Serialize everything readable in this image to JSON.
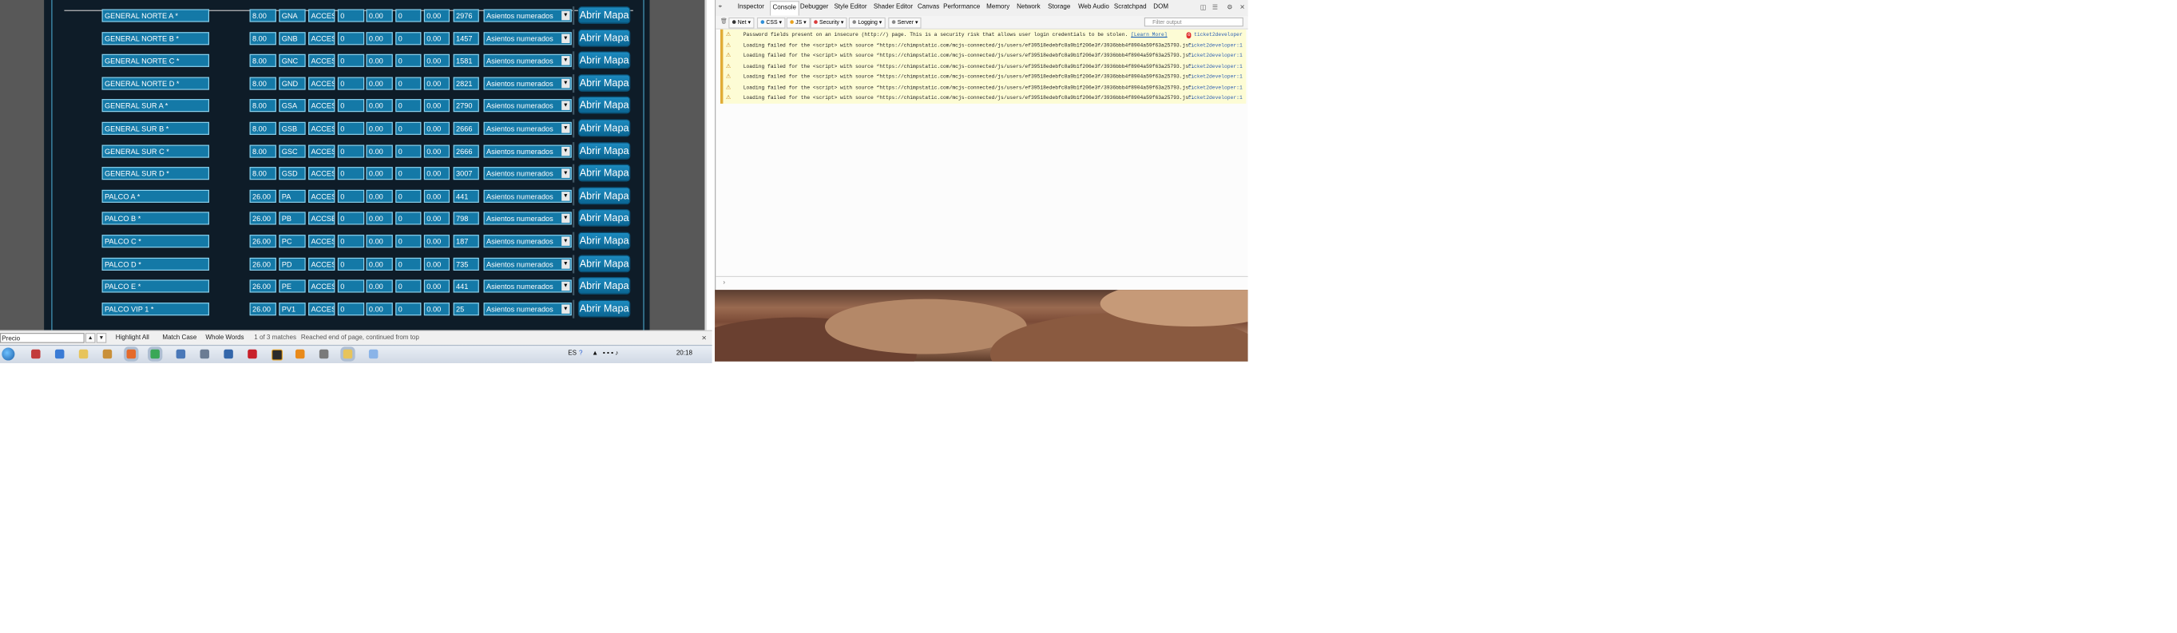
{
  "form_rows": [
    {
      "name": "GENERAL NORTE A *",
      "price": "8.00",
      "code": "GNA",
      "type": "ACCES",
      "v1": "0",
      "v2": "0.00",
      "v3": "0",
      "v4": "0.00",
      "capacity": "2976",
      "seating": "Asientos numerados",
      "button": "Abrir Mapa"
    },
    {
      "name": "GENERAL NORTE B *",
      "price": "8.00",
      "code": "GNB",
      "type": "ACCES",
      "v1": "0",
      "v2": "0.00",
      "v3": "0",
      "v4": "0.00",
      "capacity": "1457",
      "seating": "Asientos numerados",
      "button": "Abrir Mapa"
    },
    {
      "name": "GENERAL NORTE C *",
      "price": "8.00",
      "code": "GNC",
      "type": "ACCES",
      "v1": "0",
      "v2": "0.00",
      "v3": "0",
      "v4": "0.00",
      "capacity": "1581",
      "seating": "Asientos numerados",
      "button": "Abrir Mapa"
    },
    {
      "name": "GENERAL NORTE D *",
      "price": "8.00",
      "code": "GND",
      "type": "ACCES",
      "v1": "0",
      "v2": "0.00",
      "v3": "0",
      "v4": "0.00",
      "capacity": "2821",
      "seating": "Asientos numerados",
      "button": "Abrir Mapa"
    },
    {
      "name": "GENERAL SUR A *",
      "price": "8.00",
      "code": "GSA",
      "type": "ACCES",
      "v1": "0",
      "v2": "0.00",
      "v3": "0",
      "v4": "0.00",
      "capacity": "2790",
      "seating": "Asientos numerados",
      "button": "Abrir Mapa"
    },
    {
      "name": "GENERAL SUR B *",
      "price": "8.00",
      "code": "GSB",
      "type": "ACCES",
      "v1": "0",
      "v2": "0.00",
      "v3": "0",
      "v4": "0.00",
      "capacity": "2666",
      "seating": "Asientos numerados",
      "button": "Abrir Mapa"
    },
    {
      "name": "GENERAL SUR C *",
      "price": "8.00",
      "code": "GSC",
      "type": "ACCES",
      "v1": "0",
      "v2": "0.00",
      "v3": "0",
      "v4": "0.00",
      "capacity": "2666",
      "seating": "Asientos numerados",
      "button": "Abrir Mapa"
    },
    {
      "name": "GENERAL SUR D *",
      "price": "8.00",
      "code": "GSD",
      "type": "ACCES",
      "v1": "0",
      "v2": "0.00",
      "v3": "0",
      "v4": "0.00",
      "capacity": "3007",
      "seating": "Asientos numerados",
      "button": "Abrir Mapa"
    },
    {
      "name": "PALCO A *",
      "price": "26.00",
      "code": "PA",
      "type": "ACCES",
      "v1": "0",
      "v2": "0.00",
      "v3": "0",
      "v4": "0.00",
      "capacity": "441",
      "seating": "Asientos numerados",
      "button": "Abrir Mapa"
    },
    {
      "name": "PALCO B *",
      "price": "26.00",
      "code": "PB",
      "type": "ACCSE",
      "v1": "0",
      "v2": "0.00",
      "v3": "0",
      "v4": "0.00",
      "capacity": "798",
      "seating": "Asientos numerados",
      "button": "Abrir Mapa"
    },
    {
      "name": "PALCO C *",
      "price": "26.00",
      "code": "PC",
      "type": "ACCES",
      "v1": "0",
      "v2": "0.00",
      "v3": "0",
      "v4": "0.00",
      "capacity": "187",
      "seating": "Asientos numerados",
      "button": "Abrir Mapa"
    },
    {
      "name": "PALCO D *",
      "price": "26.00",
      "code": "PD",
      "type": "ACCES",
      "v1": "0",
      "v2": "0.00",
      "v3": "0",
      "v4": "0.00",
      "capacity": "735",
      "seating": "Asientos numerados",
      "button": "Abrir Mapa"
    },
    {
      "name": "PALCO E *",
      "price": "26.00",
      "code": "PE",
      "type": "ACCES",
      "v1": "0",
      "v2": "0.00",
      "v3": "0",
      "v4": "0.00",
      "capacity": "441",
      "seating": "Asientos numerados",
      "button": "Abrir Mapa"
    },
    {
      "name": "PALCO VIP 1 *",
      "price": "26.00",
      "code": "PV1",
      "type": "ACCES",
      "v1": "0",
      "v2": "0.00",
      "v3": "0",
      "v4": "0.00",
      "capacity": "25",
      "seating": "Asientos numerados",
      "button": "Abrir Mapa"
    }
  ],
  "findbar": {
    "value": "Precio",
    "prev": "▲",
    "next": "▼",
    "highlight_all": "Highlight All",
    "match_case": "Match Case",
    "whole_words": "Whole Words",
    "matches": "1 of 3 matches",
    "status": "Reached end of page, continued from top",
    "close": "×"
  },
  "devtools": {
    "tabs": [
      "Inspector",
      "Console",
      "Debugger",
      "Style Editor",
      "Shader Editor",
      "Canvas",
      "Performance",
      "Memory",
      "Network",
      "Storage",
      "Web Audio",
      "Scratchpad",
      "DOM"
    ],
    "active_tab": "Console",
    "filters": [
      {
        "label": "Net",
        "color": "#333333"
      },
      {
        "label": "CSS",
        "color": "#2f8fd8"
      },
      {
        "label": "JS",
        "color": "#e8a21e"
      },
      {
        "label": "Security",
        "color": "#d93a3a"
      },
      {
        "label": "Logging",
        "color": "#888888"
      },
      {
        "label": "Server",
        "color": "#888888"
      }
    ],
    "filter_placeholder": "Filter output",
    "messages": [
      {
        "text": "Password fields present on an insecure (http://) page. This is a security risk that allows user login credentials to be stolen.",
        "link": "[Learn More]",
        "source": "ticket2developer",
        "badge": "6"
      },
      {
        "text": "Loading failed for the <script> with source “https://chimpstatic.com/mcjs-connected/js/users/ef39518edebfc8a9b1f206e3f/3936bbb4f8904a59f63a25793.js”.",
        "source": "ticket2developer:1"
      },
      {
        "text": "Loading failed for the <script> with source “https://chimpstatic.com/mcjs-connected/js/users/ef39518edebfc8a9b1f206e3f/3936bbb4f8904a59f63a25793.js”.",
        "source": "ticket2developer:1"
      },
      {
        "text": "Loading failed for the <script> with source “https://chimpstatic.com/mcjs-connected/js/users/ef39518edebfc8a9b1f206e3f/3936bbb4f8904a59f63a25793.js”.",
        "source": "ticket2developer:1"
      },
      {
        "text": "Loading failed for the <script> with source “https://chimpstatic.com/mcjs-connected/js/users/ef39518edebfc8a9b1f206e3f/3936bbb4f8904a59f63a25793.js”.",
        "source": "ticket2developer:1"
      },
      {
        "text": "Loading failed for the <script> with source “https://chimpstatic.com/mcjs-connected/js/users/ef39518edebfc8a9b1f206e3f/3936bbb4f8904a59f63a25793.js”.",
        "source": "ticket2developer:1"
      },
      {
        "text": "Loading failed for the <script> with source “https://chimpstatic.com/mcjs-connected/js/users/ef39518edebfc8a9b1f206e3f/3936bbb4f8904a59f63a25793.js”.",
        "source": "ticket2developer:1"
      }
    ],
    "input_prompt": "›"
  },
  "taskbar": {
    "language": "ES",
    "clock": "20:18"
  }
}
